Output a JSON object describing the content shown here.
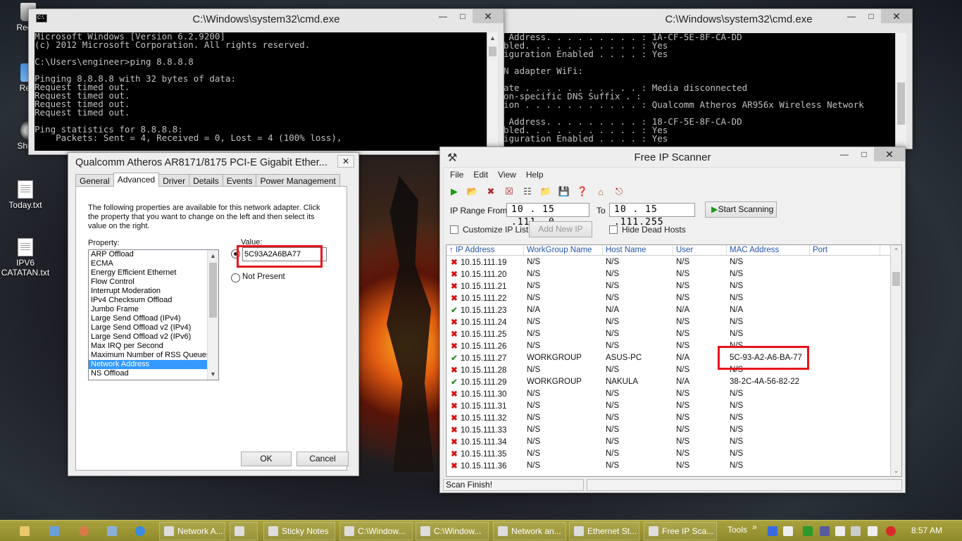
{
  "desktop": {
    "icons": [
      {
        "label": "Recyc"
      },
      {
        "label": "Rest"
      },
      {
        "label": "Shutd"
      },
      {
        "label": "Today.txt"
      },
      {
        "label": "IPV6 CATATAN.txt"
      }
    ]
  },
  "cmd1": {
    "title": "C:\\Windows\\system32\\cmd.exe",
    "icon_text": "C:\\.",
    "lines": [
      "Microsoft Windows [Version 6.2.9200]",
      "(c) 2012 Microsoft Corporation. All rights reserved.",
      "",
      "C:\\Users\\engineer>ping 8.8.8.8",
      "",
      "Pinging 8.8.8.8 with 32 bytes of data:",
      "Request timed out.",
      "Request timed out.",
      "Request timed out.",
      "Request timed out.",
      "",
      "Ping statistics for 8.8.8.8:",
      "    Packets: Sent = 4, Received = 0, Lost = 4 (100% loss),"
    ]
  },
  "cmd2": {
    "title": "C:\\Windows\\system32\\cmd.exe",
    "lines": [
      " Address. . . . . . . . . : 1A-CF-5E-8F-CA-DD",
      "bled. . . . . . . . . . . : Yes",
      "iguration Enabled . . . . : Yes",
      "",
      "N adapter WiFi:",
      "",
      "ate . . . . . . . . . . . : Media disconnected",
      "on-specific DNS Suffix . :",
      "ion . . . . . . . . . . . : Qualcomm Atheros AR956x Wireless Network",
      "",
      " Address. . . . . . . . . : 18-CF-5E-8F-CA-DD",
      "bled. . . . . . . . . . . : Yes",
      "iguration Enabled . . . . : Yes"
    ]
  },
  "nic_dialog": {
    "title": "Qualcomm Atheros AR8171/8175 PCI-E Gigabit Ether...",
    "tabs": [
      "General",
      "Advanced",
      "Driver",
      "Details",
      "Events",
      "Power Management"
    ],
    "description": "The following properties are available for this network adapter. Click the property that you want to change on the left and then select its value on the right.",
    "property_label": "Property:",
    "value_label": "Value:",
    "properties": [
      "ARP Offload",
      "ECMA",
      "Energy Efficient Ethernet",
      "Flow Control",
      "Interrupt Moderation",
      "IPv4 Checksum Offload",
      "Jumbo Frame",
      "Large Send Offload (IPv4)",
      "Large Send Offload v2 (IPv4)",
      "Large Send Offload v2 (IPv6)",
      "Max IRQ per Second",
      "Maximum Number of RSS Queues",
      "Network Address",
      "NS Offload"
    ],
    "selected_property": "Network Address",
    "value": "5C93A2A6BA77",
    "not_present_label": "Not Present",
    "ok_label": "OK",
    "cancel_label": "Cancel"
  },
  "scanner": {
    "title": "Free IP Scanner",
    "menu": [
      "File",
      "Edit",
      "View",
      "Help"
    ],
    "ip_range_from_label": "IP Range From",
    "ip_from": "10 . 15 .111. 0",
    "to_label": "To",
    "ip_to": "10 . 15 .111.255",
    "start_label": "Start Scanning",
    "customize_label": "Customize IP List",
    "add_new_ip_label": "Add New IP",
    "hide_dead_label": "Hide Dead Hosts",
    "columns": [
      "IP Address",
      "WorkGroup Name",
      "Host Name",
      "User",
      "MAC Address",
      "Port"
    ],
    "rows": [
      {
        "status": "dead",
        "ip": "10.15.111.19",
        "wg": "N/S",
        "host": "N/S",
        "user": "N/S",
        "mac": "N/S",
        "port": ""
      },
      {
        "status": "dead",
        "ip": "10.15.111.20",
        "wg": "N/S",
        "host": "N/S",
        "user": "N/S",
        "mac": "N/S",
        "port": ""
      },
      {
        "status": "dead",
        "ip": "10.15.111.21",
        "wg": "N/S",
        "host": "N/S",
        "user": "N/S",
        "mac": "N/S",
        "port": ""
      },
      {
        "status": "dead",
        "ip": "10.15.111.22",
        "wg": "N/S",
        "host": "N/S",
        "user": "N/S",
        "mac": "N/S",
        "port": ""
      },
      {
        "status": "alive",
        "ip": "10.15.111.23",
        "wg": "N/A",
        "host": "N/A",
        "user": "N/A",
        "mac": "N/A",
        "port": ""
      },
      {
        "status": "dead",
        "ip": "10.15.111.24",
        "wg": "N/S",
        "host": "N/S",
        "user": "N/S",
        "mac": "N/S",
        "port": ""
      },
      {
        "status": "dead",
        "ip": "10.15.111.25",
        "wg": "N/S",
        "host": "N/S",
        "user": "N/S",
        "mac": "N/S",
        "port": ""
      },
      {
        "status": "dead",
        "ip": "10.15.111.26",
        "wg": "N/S",
        "host": "N/S",
        "user": "N/S",
        "mac": "N/S",
        "port": ""
      },
      {
        "status": "alive",
        "ip": "10.15.111.27",
        "wg": "WORKGROUP",
        "host": "ASUS-PC",
        "user": "N/A",
        "mac": "5C-93-A2-A6-BA-77",
        "port": ""
      },
      {
        "status": "dead",
        "ip": "10.15.111.28",
        "wg": "N/S",
        "host": "N/S",
        "user": "N/S",
        "mac": "N/S",
        "port": ""
      },
      {
        "status": "alive",
        "ip": "10.15.111.29",
        "wg": "WORKGROUP",
        "host": "NAKULA",
        "user": "N/A",
        "mac": "38-2C-4A-56-82-22",
        "port": ""
      },
      {
        "status": "dead",
        "ip": "10.15.111.30",
        "wg": "N/S",
        "host": "N/S",
        "user": "N/S",
        "mac": "N/S",
        "port": ""
      },
      {
        "status": "dead",
        "ip": "10.15.111.31",
        "wg": "N/S",
        "host": "N/S",
        "user": "N/S",
        "mac": "N/S",
        "port": ""
      },
      {
        "status": "dead",
        "ip": "10.15.111.32",
        "wg": "N/S",
        "host": "N/S",
        "user": "N/S",
        "mac": "N/S",
        "port": ""
      },
      {
        "status": "dead",
        "ip": "10.15.111.33",
        "wg": "N/S",
        "host": "N/S",
        "user": "N/S",
        "mac": "N/S",
        "port": ""
      },
      {
        "status": "dead",
        "ip": "10.15.111.34",
        "wg": "N/S",
        "host": "N/S",
        "user": "N/S",
        "mac": "N/S",
        "port": ""
      },
      {
        "status": "dead",
        "ip": "10.15.111.35",
        "wg": "N/S",
        "host": "N/S",
        "user": "N/S",
        "mac": "N/S",
        "port": ""
      },
      {
        "status": "dead",
        "ip": "10.15.111.36",
        "wg": "N/S",
        "host": "N/S",
        "user": "N/S",
        "mac": "N/S",
        "port": ""
      }
    ],
    "status_text": "Scan Finish!"
  },
  "taskbar": {
    "items": [
      {
        "label": "Network A...",
        "icon": "chrome-icon"
      },
      {
        "label": "",
        "icon": "app-icon"
      },
      {
        "label": "Sticky Notes",
        "icon": "sticky-notes-icon"
      },
      {
        "label": "C:\\Window...",
        "icon": "cmd-icon"
      },
      {
        "label": "C:\\Window...",
        "icon": "cmd-icon"
      },
      {
        "label": "Network an...",
        "icon": "network-icon"
      },
      {
        "label": "Ethernet St...",
        "icon": "ethernet-icon"
      },
      {
        "label": "Free IP Sca...",
        "icon": "scanner-icon"
      }
    ],
    "tools_label": "Tools",
    "clock": "8:57 AM"
  },
  "colors": {
    "taskbar": "#9a9434",
    "highlight_red": "#e8141c",
    "dead_mark": "#d41414",
    "alive_mark": "#2e8b2e"
  }
}
